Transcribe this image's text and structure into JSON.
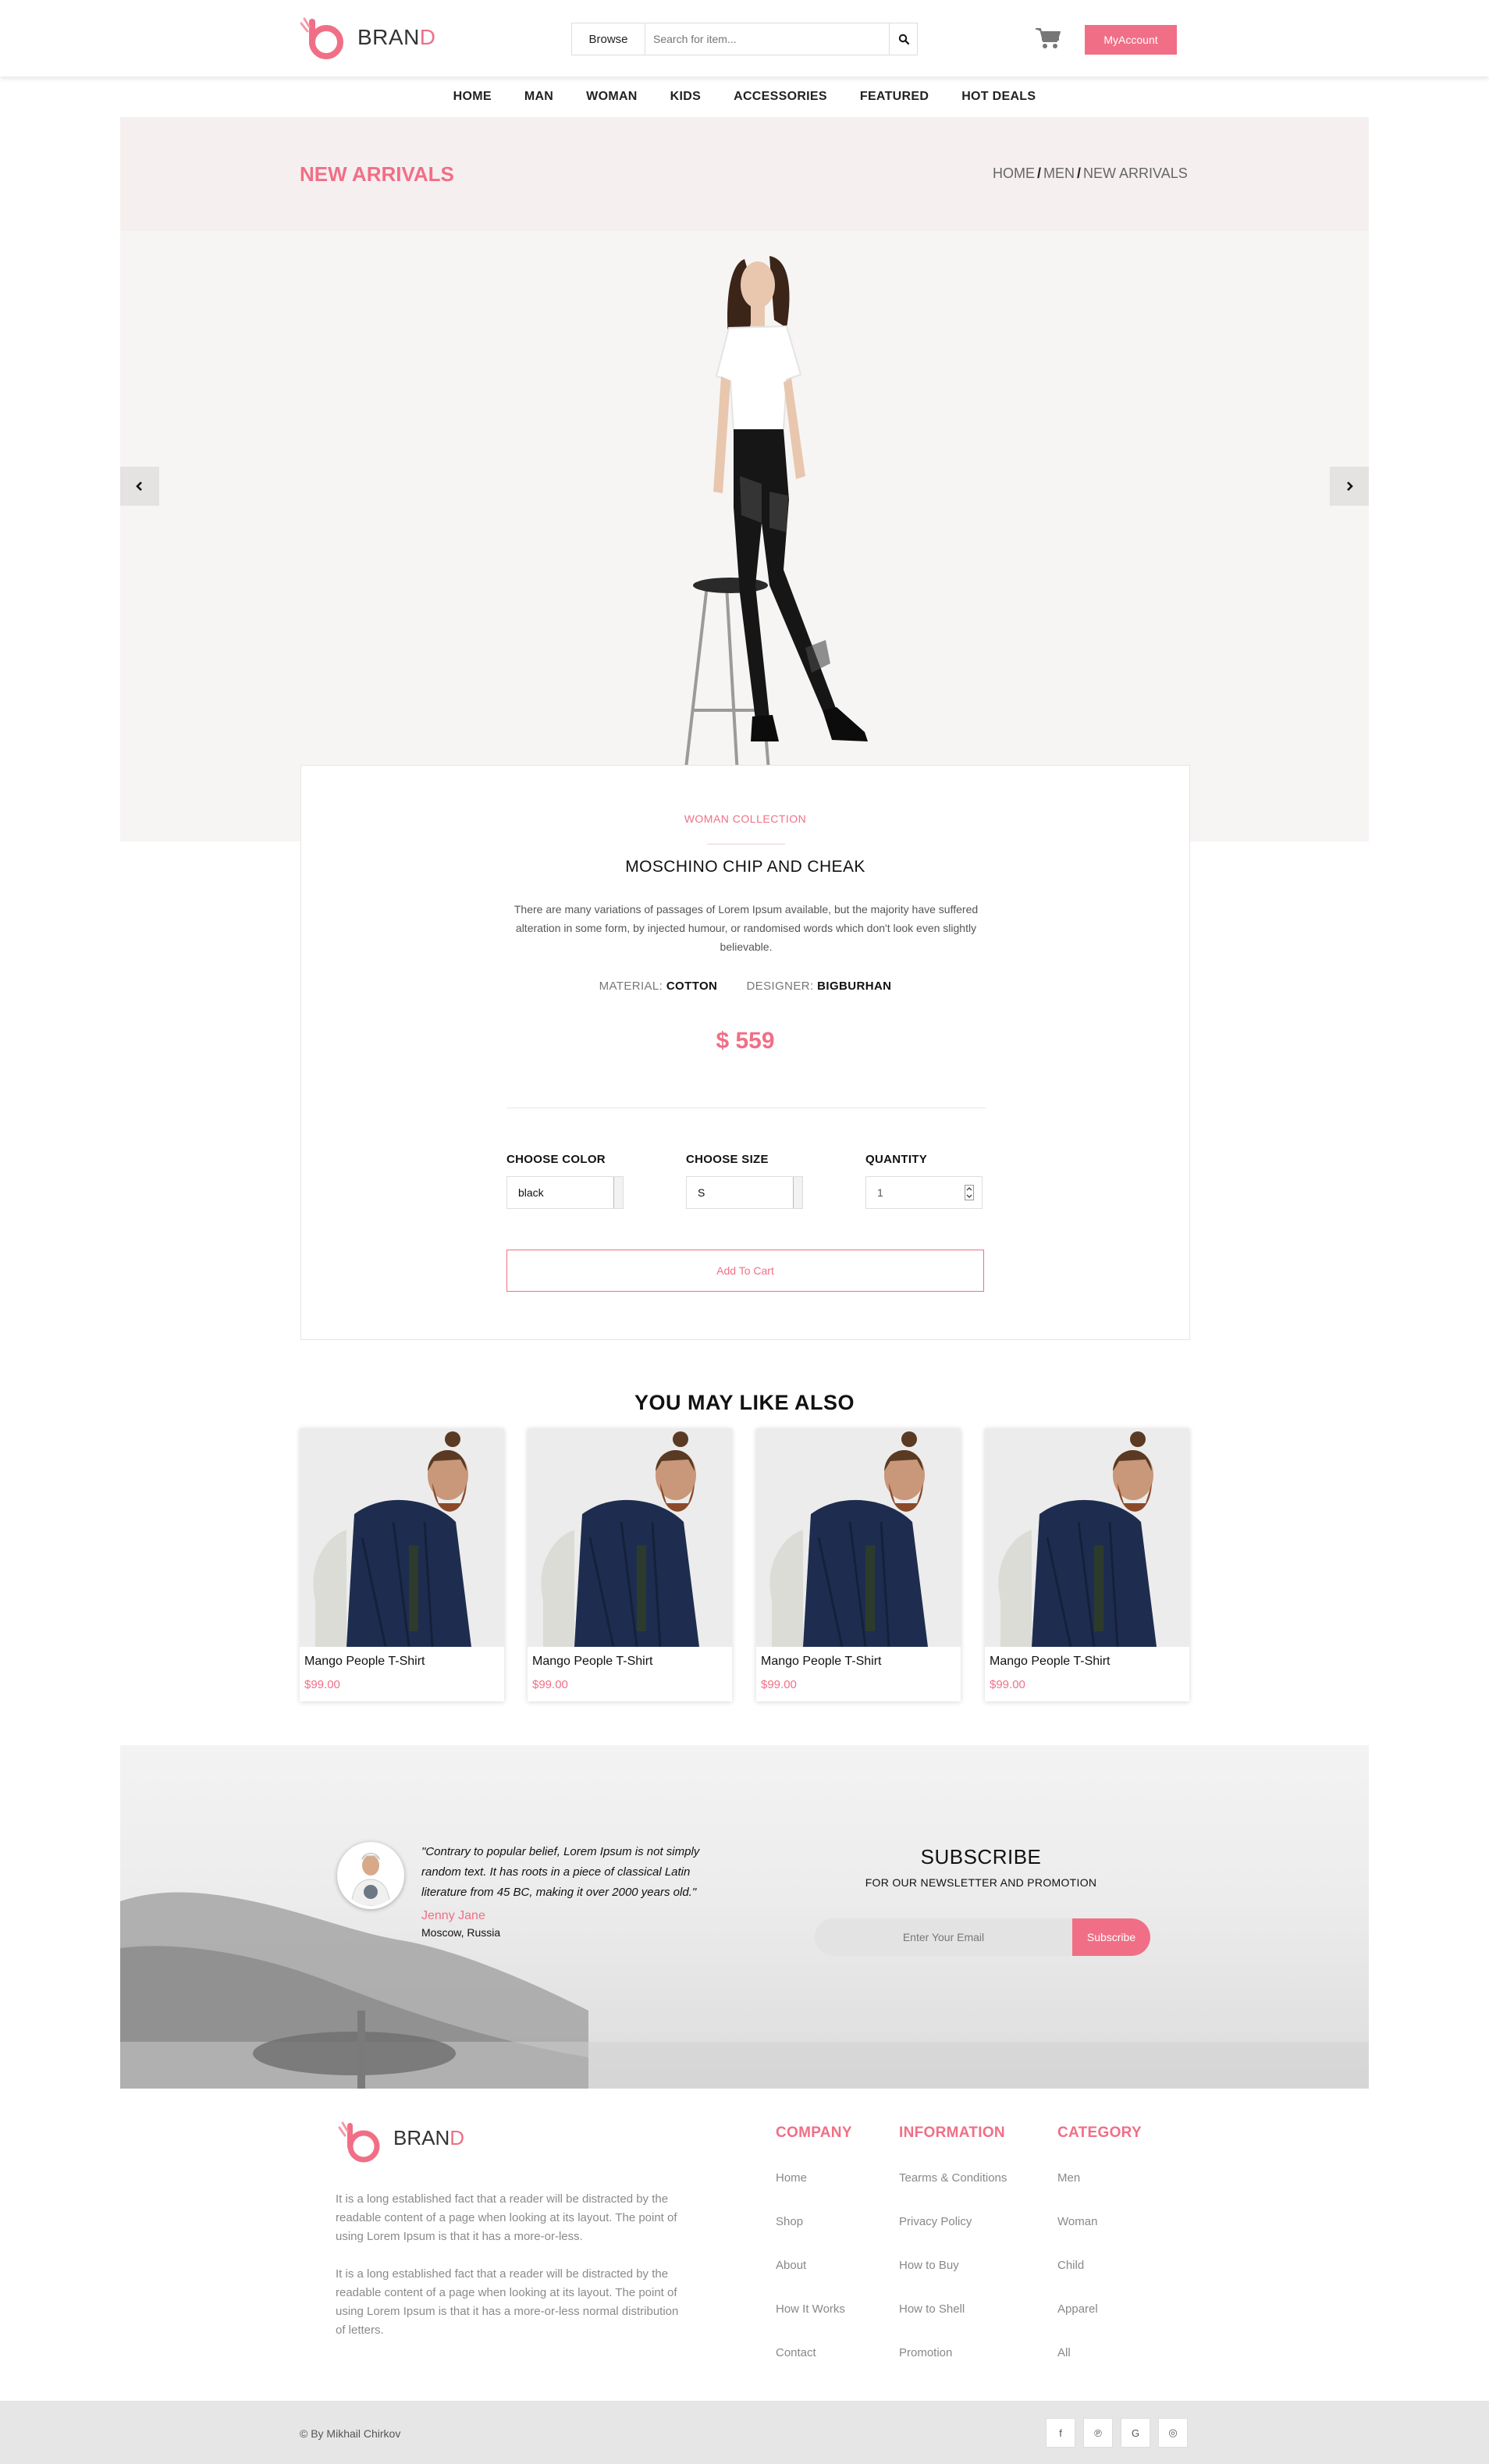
{
  "brand": {
    "prefix": "BRAN",
    "accent_letter": "D",
    "accent_color": "#f06f86"
  },
  "header": {
    "browse_label": "Browse",
    "search_placeholder": "Search for item...",
    "account_label": "MyAccount"
  },
  "nav": [
    "HOME",
    "MAN",
    "WOMAN",
    "KIDS",
    "ACCESSORIES",
    "FEATURED",
    "HOT DEALS"
  ],
  "hero": {
    "title": "NEW ARRIVALS",
    "breadcrumb": [
      "HOME",
      "MEN",
      "NEW ARRIVALS"
    ]
  },
  "product": {
    "collection": "WOMAN COLLECTION",
    "title": "MOSCHINO CHIP AND CHEAK",
    "description": "There are many variations of passages of Lorem Ipsum available, but the majority have suffered alteration in some form, by injected humour, or randomised words which don't look even slightly believable.",
    "material_label": "MATERIAL:",
    "material_value": "COTTON",
    "designer_label": "DESIGNER:",
    "designer_value": "BIGBURHAN",
    "price": "$ 559",
    "color_label": "CHOOSE COLOR",
    "color_value": "black",
    "size_label": "CHOOSE SIZE",
    "size_value": "S",
    "quantity_label": "QUANTITY",
    "quantity_value": "1",
    "add_to_cart": "Add To Cart"
  },
  "related": {
    "title": "YOU MAY LIKE ALSO",
    "items": [
      {
        "name": "Mango People T-Shirt",
        "price": "$99.00"
      },
      {
        "name": "Mango People T-Shirt",
        "price": "$99.00"
      },
      {
        "name": "Mango People T-Shirt",
        "price": "$99.00"
      },
      {
        "name": "Mango People T-Shirt",
        "price": "$99.00"
      }
    ]
  },
  "testimonial": {
    "quote": "\"Contrary to popular belief, Lorem Ipsum is not simply random text. It has roots in a piece of classical Latin literature from 45 BC, making it over 2000 years old.\"",
    "author": "Jenny Jane",
    "location": "Moscow, Russia"
  },
  "subscribe": {
    "title": "SUBSCRIBE",
    "subtitle": "FOR OUR NEWSLETTER AND PROMOTION",
    "placeholder": "Enter Your Email",
    "button": "Subscribe"
  },
  "footer": {
    "para1": "It is a long established fact that a reader will be distracted by the readable content of a page when looking at its layout. The point of using Lorem Ipsum is that it has a more-or-less.",
    "para2": "It is a long established fact that a reader will be distracted by the readable content of a page when looking at its layout. The point of using Lorem Ipsum is that it has a more-or-less normal distribution of letters.",
    "columns": [
      {
        "title": "COMPANY",
        "links": [
          "Home",
          "Shop",
          "About",
          "How It Works",
          "Contact"
        ]
      },
      {
        "title": "INFORMATION",
        "links": [
          "Tearms & Conditions",
          "Privacy Policy",
          "How to Buy",
          "How to Shell",
          "Promotion"
        ]
      },
      {
        "title": "CATEGORY",
        "links": [
          "Men",
          "Woman",
          "Child",
          "Apparel",
          "All"
        ]
      }
    ],
    "copyright": "© By Mikhail Chirkov",
    "social": [
      "f",
      "℗",
      "G",
      "◎"
    ]
  },
  "icons": {
    "search": "search-icon",
    "cart": "cart-icon",
    "prev": "chevron-left-icon",
    "next": "chevron-right-icon",
    "social": [
      "facebook-icon",
      "pinterest-icon",
      "google-icon",
      "instagram-icon"
    ]
  }
}
